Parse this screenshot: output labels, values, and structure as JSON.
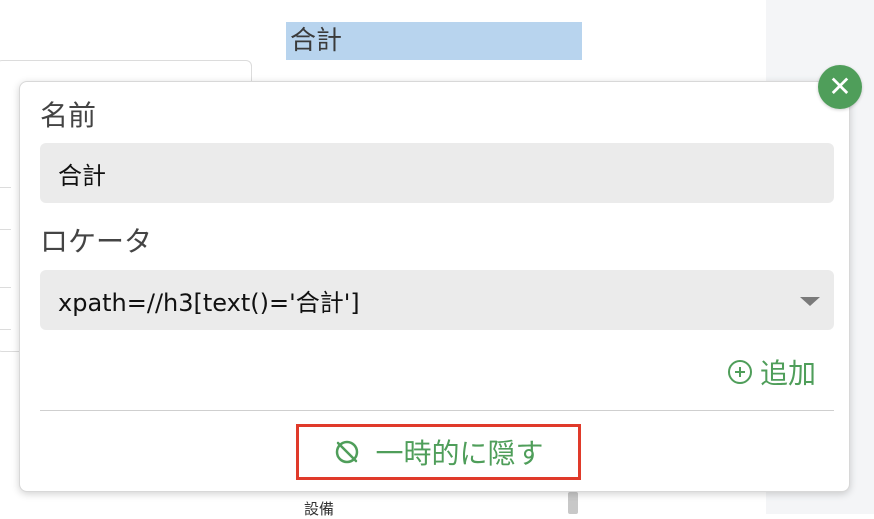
{
  "background": {
    "heading": "合計",
    "bottom_text": "設備"
  },
  "popup": {
    "name": {
      "label": "名前",
      "value": "合計"
    },
    "locator": {
      "label": "ロケータ",
      "value": "xpath=//h3[text()='合計']"
    },
    "add_label": "追加",
    "hide_label": "一時的に隠す",
    "close_icon": "close-icon"
  },
  "colors": {
    "accent": "#4f9e5a",
    "highlight_border": "#e03a2a",
    "selection": "#b8d4ee",
    "field_bg": "#ebebeb"
  }
}
